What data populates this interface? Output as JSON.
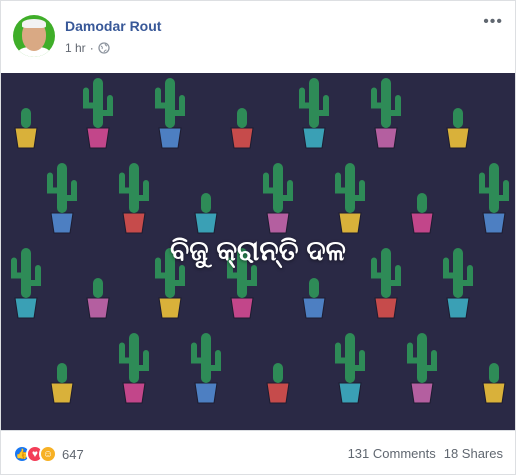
{
  "post": {
    "author": "Damodar Rout",
    "time": "1 hr",
    "privacy_icon": "globe-icon",
    "more_icon": "more-options-icon"
  },
  "image": {
    "text": "ବିଜୁ କ୍ରାନ୍ତି ଦଳ",
    "background_color": "#2a2945"
  },
  "footer": {
    "reaction_icons": [
      "like-icon",
      "love-icon",
      "haha-icon"
    ],
    "reaction_count": "647",
    "comments": "131 Comments",
    "shares": "18 Shares"
  }
}
